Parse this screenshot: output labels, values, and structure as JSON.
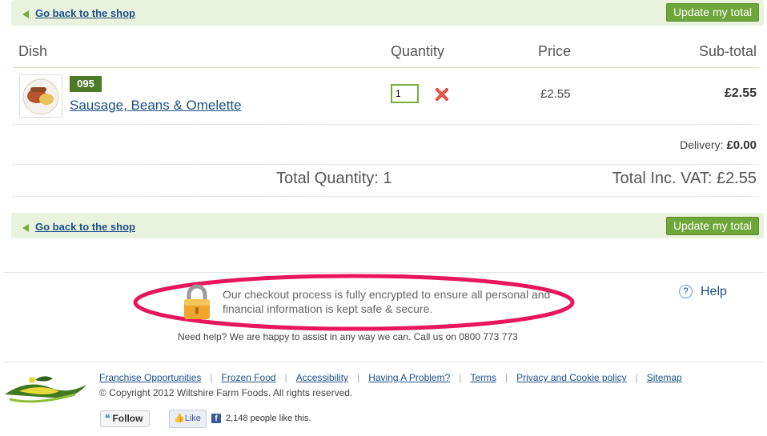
{
  "nav": {
    "back_link": "Go back to the shop",
    "update_button": "Update my total"
  },
  "table": {
    "headers": {
      "dish": "Dish",
      "quantity": "Quantity",
      "price": "Price",
      "subtotal": "Sub-total"
    },
    "rows": [
      {
        "code": "095",
        "name": "Sausage, Beans & Omelette",
        "quantity": "1",
        "price": "£2.55",
        "subtotal": "£2.55"
      }
    ]
  },
  "totals": {
    "delivery_label": "Delivery:",
    "delivery_value": "£0.00",
    "total_quantity": "Total Quantity: 1",
    "total_vat": "Total Inc. VAT: £2.55"
  },
  "security": {
    "message": "Our checkout process is fully encrypted to ensure all personal and financial information is kept safe & secure.",
    "help_link": "Help",
    "need_help": "Need help? We are happy to assist in any way we can. Call us on 0800 773 773"
  },
  "footer": {
    "links": [
      "Franchise Opportunities",
      "Frozen Food",
      "Accessibility",
      "Having A Problem?",
      "Terms",
      "Privacy and Cookie policy",
      "Sitemap"
    ],
    "copyright": "© Copyright 2012 Wiltshire Farm Foods. All rights reserved.",
    "twitter_follow": "Follow",
    "facebook_like": "Like",
    "facebook_count": "2,148 people like this."
  },
  "colors": {
    "accent_green": "#6fa63a",
    "bar_bg": "#e9f2dd",
    "link_blue": "#1b4f8a",
    "highlight": "#e8175d"
  },
  "icons": [
    "back-arrow-icon",
    "remove-icon",
    "lock-icon",
    "help-icon",
    "twitter-icon",
    "facebook-icon"
  ]
}
